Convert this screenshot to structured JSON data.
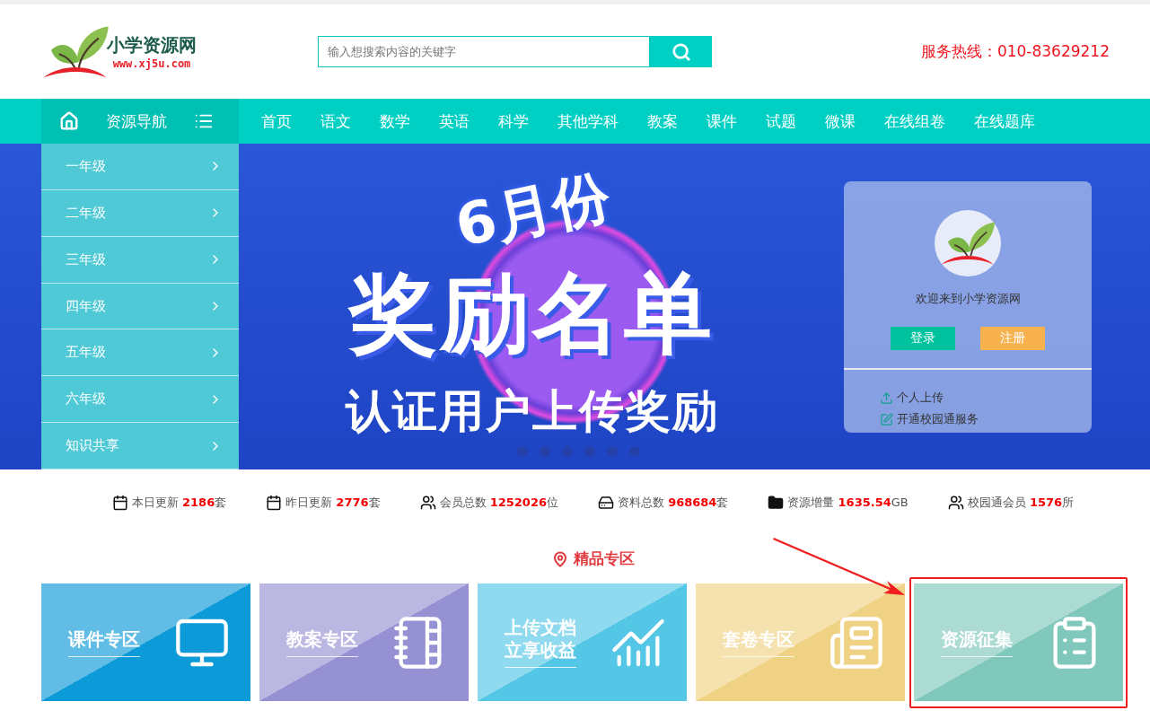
{
  "header": {
    "logo_name": "小学资源网",
    "logo_url": "www.xj5u.com",
    "search": {
      "placeholder": "输入想搜索内容的关键字"
    },
    "hotline": "服务热线：010-83629212"
  },
  "nav": {
    "category_label": "资源导航",
    "items": [
      {
        "label": "首页"
      },
      {
        "label": "语文"
      },
      {
        "label": "数学"
      },
      {
        "label": "英语"
      },
      {
        "label": "科学"
      },
      {
        "label": "其他学科"
      },
      {
        "label": "教案"
      },
      {
        "label": "课件"
      },
      {
        "label": "试题"
      },
      {
        "label": "微课"
      },
      {
        "label": "在线组卷"
      },
      {
        "label": "在线题库"
      }
    ]
  },
  "sidebar": {
    "items": [
      {
        "label": "一年级"
      },
      {
        "label": "二年级"
      },
      {
        "label": "三年级"
      },
      {
        "label": "四年级"
      },
      {
        "label": "五年级"
      },
      {
        "label": "六年级"
      },
      {
        "label": "知识共享"
      }
    ]
  },
  "banner": {
    "month": "6月份",
    "headline": "奖励名单",
    "subline": "认证用户上传奖励"
  },
  "login_card": {
    "welcome": "欢迎来到小学资源网",
    "login": "登录",
    "register": "注册",
    "links": [
      {
        "kind": "upload",
        "label": "个人上传"
      },
      {
        "kind": "edit",
        "label": "开通校园通服务"
      }
    ]
  },
  "stats": [
    {
      "kind": "calendar",
      "text": "本日更新 **2186**套"
    },
    {
      "kind": "calendar",
      "text": "昨日更新 **2776**套"
    },
    {
      "kind": "users",
      "text": "会员总数 **1252026**位"
    },
    {
      "kind": "drive",
      "text": "资料总数 **968684**套"
    },
    {
      "kind": "folder",
      "text": "资源增量 **1635.54**GB"
    },
    {
      "kind": "users",
      "text": "校园通会员 **1576**所"
    }
  ],
  "section_title": "精品专区",
  "cards": [
    {
      "kind": "monitor",
      "lines": [
        "课件专区"
      ],
      "color": "#0d9ad9",
      "highlighted": false
    },
    {
      "kind": "notebook",
      "lines": [
        "教案专区"
      ],
      "color": "#9691d2",
      "highlighted": false
    },
    {
      "kind": "chart",
      "lines": [
        "上传文档",
        "立享收益"
      ],
      "color": "#54c6e6",
      "highlighted": false
    },
    {
      "kind": "newspaper",
      "lines": [
        "套卷专区"
      ],
      "color": "#efd283",
      "highlighted": false
    },
    {
      "kind": "form",
      "lines": [
        "资源征集"
      ],
      "color": "#80c8bb",
      "highlighted": true
    }
  ]
}
